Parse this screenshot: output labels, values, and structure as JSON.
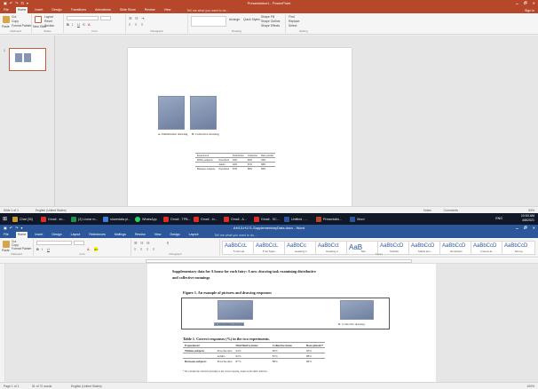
{
  "ppt": {
    "title": "Presentation1 - PowerPoint",
    "qat": [
      "▣",
      "↶",
      "↷",
      "⊡",
      "▾"
    ],
    "controls": [
      "🗕",
      "🗗",
      "✕"
    ],
    "tabs": [
      "File",
      "Home",
      "Insert",
      "Design",
      "Transitions",
      "Animations",
      "Slide Show",
      "Review",
      "View"
    ],
    "active_tab": "Home",
    "tell_me": "Tell me what you want to do...",
    "sign_in": "Sign in",
    "share": "Share",
    "groups": [
      "Clipboard",
      "Slides",
      "Font",
      "Paragraph",
      "Drawing",
      "Editing"
    ],
    "buttons": {
      "cut": "Cut",
      "copy": "Copy",
      "format_painter": "Format Painter",
      "paste": "Paste",
      "new_slide": "New Slide",
      "layout": "Layout",
      "reset": "Reset",
      "section": "Section",
      "shape_fill": "Shape Fill",
      "shape_outline": "Shape Outline",
      "shape_effects": "Shape Effects",
      "find": "Find",
      "replace": "Replace",
      "select": "Select",
      "arrange": "Arrange",
      "quick_styles": "Quick Styles"
    },
    "slide_number": "1",
    "captions": [
      "A. Distributive drawing",
      "B. Collective drawing"
    ],
    "table": [
      [
        "Experiment",
        "",
        "Distributive",
        "Collective",
        "Bare plurals"
      ],
      [
        "Within-subjects",
        "Preschool",
        "94%",
        "90%",
        "93%"
      ],
      [
        "",
        "Adults",
        "92%",
        "87%",
        "88%"
      ],
      [
        "Between-subjects",
        "Preschool",
        "87%",
        "88%",
        "86%"
      ]
    ],
    "status_left": "Slide 1 of 1",
    "status_lang": "English (United States)",
    "status_notes": "Notes",
    "status_comments": "Comments",
    "status_zoom": "53%"
  },
  "taskbar": {
    "items": [
      {
        "label": "Chat (30)",
        "color": "#c49a2a"
      },
      {
        "label": "Gmail - im...",
        "color": "#d93025"
      },
      {
        "label": "(2) Linear m...",
        "color": "#1f8f4a"
      },
      {
        "label": "sharedata.pl...",
        "color": "#3b7dd8"
      },
      {
        "label": "WhatsApp",
        "color": "#25d366"
      },
      {
        "label": "Gmail - TPB...",
        "color": "#d93025"
      },
      {
        "label": "Gmail - In...",
        "color": "#d93025"
      },
      {
        "label": "Gmail - A...",
        "color": "#d93025"
      },
      {
        "label": "Gmail - SC...",
        "color": "#d93025"
      },
      {
        "label": "Untitled - ...",
        "color": "#2b579a"
      },
      {
        "label": "Presentatio...",
        "color": "#b7472a"
      },
      {
        "label": "Word",
        "color": "#2b579a"
      }
    ],
    "lang": "ENG",
    "time": "10:53 AM",
    "date": "4/8/2021"
  },
  "word": {
    "title": "AH13-H171-SupplementaryData.docx - Word",
    "qat": [
      "▣",
      "↶",
      "↷",
      "▾"
    ],
    "controls": [
      "🗕",
      "🗗",
      "✕"
    ],
    "tabs": [
      "File",
      "Home",
      "Insert",
      "Design",
      "Layout",
      "References",
      "Mailings",
      "Review",
      "View",
      "Design",
      "Layout"
    ],
    "active_tab": "Home",
    "tell_me": "Tell me what you want to do...",
    "groups": [
      "Clipboard",
      "Font",
      "Paragraph",
      "Styles"
    ],
    "buttons": {
      "cut": "Cut",
      "copy": "Copy",
      "format_painter": "Format Painter",
      "paste": "Paste"
    },
    "styles": [
      {
        "sample": "AaBbCcL",
        "name": "¶ Normal"
      },
      {
        "sample": "AaBbCcL",
        "name": "¶ No Spac..."
      },
      {
        "sample": "AaBbCc",
        "name": "Heading 1"
      },
      {
        "sample": "AaBbCcI",
        "name": "Heading 2"
      },
      {
        "sample": "AaB",
        "name": "Title"
      },
      {
        "sample": "AaBbCcD",
        "name": "Subtitle"
      },
      {
        "sample": "AaBbCcD",
        "name": "Subtle Em..."
      },
      {
        "sample": "AaBbCcD",
        "name": "Emphasis"
      },
      {
        "sample": "AaBbCcD",
        "name": "Intense E..."
      },
      {
        "sample": "AaBbCcD",
        "name": "Strong"
      }
    ],
    "doc_title": "Supplementary data for A house for each fairy: A new drawing task examining distributive and collective meanings",
    "doc_title_line1": "Supplementary data for A house for each fairy: A new drawing task examining distributive",
    "doc_title_line2": "and collective meanings",
    "figure_title": "Figure 1. An example of pictures and drawing responses",
    "captions": [
      "A. Distributive drawing",
      "B. Collective drawing"
    ],
    "table_title": "Table 1. Correct responses (%) in the two experiments.",
    "table": [
      [
        "Experiment",
        "",
        "Distributive items",
        "Collective items",
        "Bare plurals*"
      ],
      [
        "Within-subjects",
        "Preschoolers",
        "94%",
        "90%",
        "93%"
      ],
      [
        "",
        "Adults",
        "92%",
        "87%",
        "88%"
      ],
      [
        "Between-subjects",
        "Preschoolers",
        "87%",
        "88%",
        "86%"
      ]
    ],
    "table_note": "* We consider the collective drawings as the correct response, based on the adults' behavior.",
    "status_left": "Page 1 of 1",
    "status_words": "51 of 72 words",
    "status_lang": "English (United States)",
    "status_zoom": "100%"
  }
}
